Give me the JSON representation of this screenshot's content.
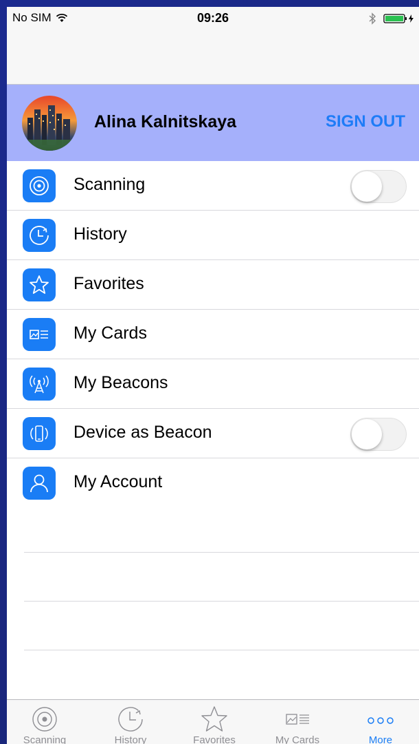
{
  "status": {
    "carrier": "No SIM",
    "time": "09:26"
  },
  "profile": {
    "name": "Alina Kalnitskaya",
    "sign_out": "SIGN OUT"
  },
  "menu": [
    {
      "label": "Scanning",
      "icon": "scanning-icon",
      "toggle": false
    },
    {
      "label": "History",
      "icon": "history-icon"
    },
    {
      "label": "Favorites",
      "icon": "star-icon"
    },
    {
      "label": "My Cards",
      "icon": "cards-icon"
    },
    {
      "label": "My Beacons",
      "icon": "beacon-icon"
    },
    {
      "label": "Device as Beacon",
      "icon": "device-icon",
      "toggle": false
    },
    {
      "label": "My Account",
      "icon": "account-icon"
    }
  ],
  "tabs": [
    {
      "label": "Scanning",
      "icon": "scanning-icon"
    },
    {
      "label": "History",
      "icon": "history-icon"
    },
    {
      "label": "Favorites",
      "icon": "star-icon"
    },
    {
      "label": "My Cards",
      "icon": "cards-icon"
    },
    {
      "label": "More",
      "icon": "more-icon",
      "active": true
    }
  ],
  "colors": {
    "accent": "#1a7df5",
    "profile_bg": "#a5b0fb",
    "frame": "#1b2a8f"
  }
}
